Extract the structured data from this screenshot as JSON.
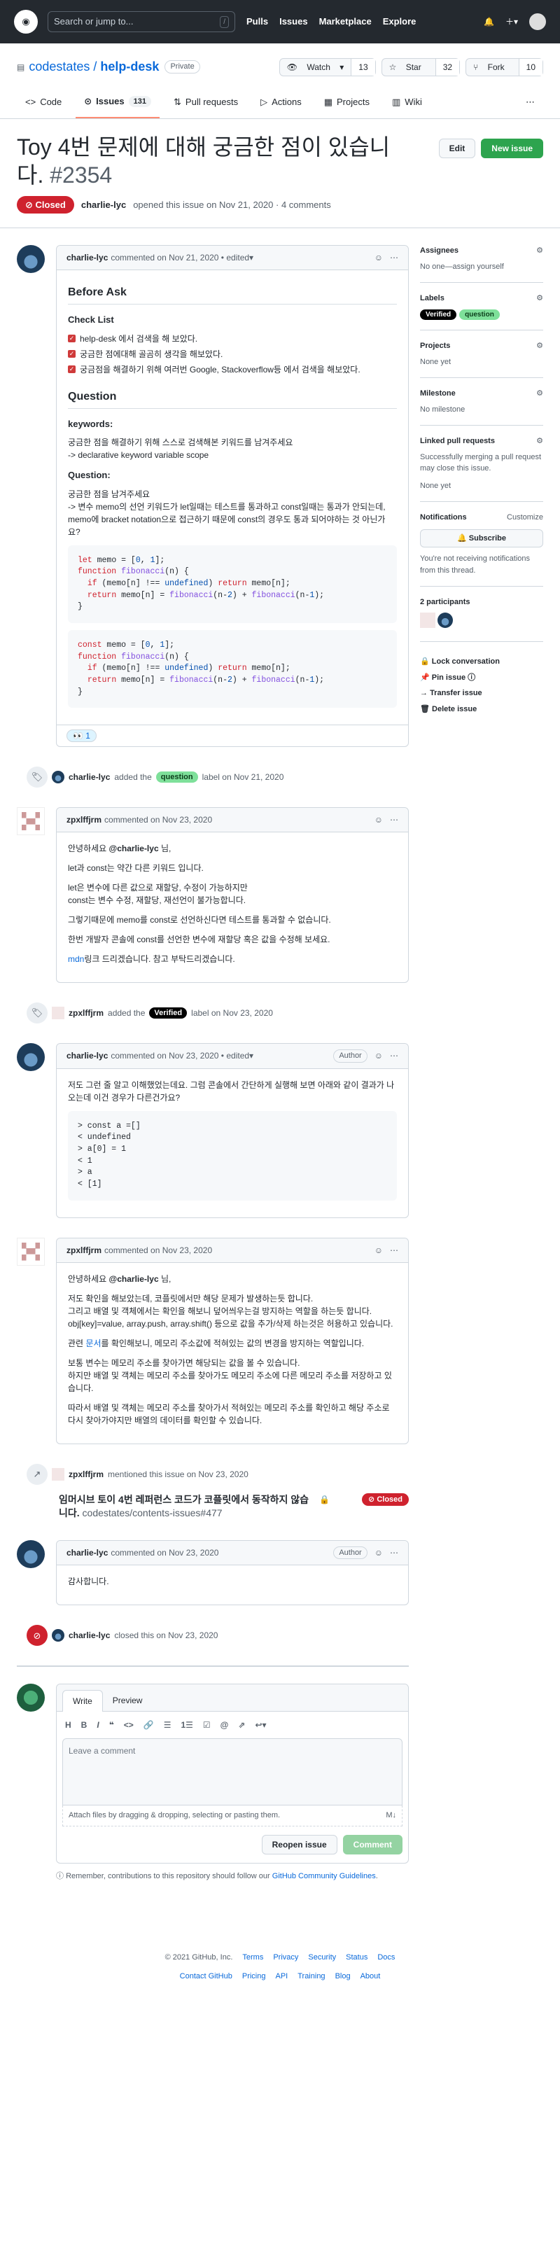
{
  "topbar": {
    "search_placeholder": "Search or jump to...",
    "slash": "/",
    "nav": [
      "Pulls",
      "Issues",
      "Marketplace",
      "Explore"
    ]
  },
  "repo": {
    "owner": "codestates",
    "name": "help-desk",
    "visibility": "Private",
    "watch": "Watch",
    "watch_count": "13",
    "star": "Star",
    "star_count": "32",
    "fork": "Fork",
    "fork_count": "10"
  },
  "tabs": {
    "code": "Code",
    "issues": "Issues",
    "issues_count": "131",
    "pulls": "Pull requests",
    "actions": "Actions",
    "projects": "Projects",
    "wiki": "Wiki"
  },
  "issue": {
    "title": "Toy 4번 문제에 대해 궁금한 점이 있습니다.",
    "number": "#2354",
    "edit": "Edit",
    "new_issue": "New issue",
    "state": "Closed",
    "author": "charlie-lyc",
    "opened": "opened this issue on Nov 21, 2020 · 4 comments"
  },
  "c1": {
    "author": "charlie-lyc",
    "meta": "commented on Nov 21, 2020 • edited",
    "h_before": "Before Ask",
    "h_check": "Check List",
    "checks": [
      "help-desk 에서 검색을 해 보았다.",
      "궁금한 점에대해 골곰히 생각을 해보았다.",
      "궁금점을 해결하기 위해 여러번 Google, Stackoverflow등 에서 검색을 해보았다."
    ],
    "h_question": "Question",
    "h_keywords": "keywords:",
    "kw1": "궁금한 점을 해결하기 위해 스스로 검색해본 키워드를 남겨주세요",
    "kw2": "-> declarative keyword variable scope",
    "h_q2": "Question:",
    "q1": "궁금한 점을 남겨주세요",
    "q2": "-> 변수 memo의 선언 키워드가 let일때는 테스트를 통과하고 const일때는 통과가 안되는데, memo에 bracket notation으로 접근하기 때문에 const의 경우도 통과 되어야하는 것 아닌가요?",
    "reaction": "👀 1"
  },
  "ev1": {
    "user": "charlie-lyc",
    "text": "added the",
    "label": "question",
    "after": "label on Nov 21, 2020"
  },
  "c2": {
    "author": "zpxlffjrm",
    "meta": "commented on Nov 23, 2020",
    "p1a": "안녕하세요",
    "mention": "@charlie-lyc",
    "p1b": "님,",
    "p2": "let과 const는 약간 다른 키워드 입니다.",
    "p3": "let은 변수에 다른 값으로 재할당, 수정이 가능하지만",
    "p3b": "const는 변수 수정, 재할당, 재선언이 불가능합니다.",
    "p4": "그렇기때문에 memo를 const로 선언하신다면 테스트를 통과할 수 없습니다.",
    "p5": "한번 개발자 콘솔에 const를 선언한 변수에 재할당 혹은 값을 수정해 보세요.",
    "link": "mdn",
    "p6": "링크 드리겠습니다. 참고 부탁드리겠습니다."
  },
  "ev2": {
    "user": "zpxlffjrm",
    "text": "added the",
    "label": "Verified",
    "after": "label on Nov 23, 2020"
  },
  "c3": {
    "author": "charlie-lyc",
    "meta": "commented on Nov 23, 2020 • edited",
    "badge": "Author",
    "p1": "저도 그런 줄 알고 이해했었는데요. 그럼 콘솔에서 간단하게 실행해 보면 아래와 같이 결과가 나오는데 이건 경우가 다른건가요?"
  },
  "c4": {
    "author": "zpxlffjrm",
    "meta": "commented on Nov 23, 2020",
    "p1a": "안녕하세요",
    "mention": "@charlie-lyc",
    "p1b": "님,",
    "p2": "저도 확인을 해보았는데, 코플릿에서만 해당 문제가 발생하는듯 합니다.",
    "p2b": "그리고 배열 및 객체에서는 확인을 해보니 덮어씌우는걸 방지하는 역할을 하는듯 합니다.",
    "p2c": "obj[key]=value, array.push, array.shift() 등으로 값을 추가/삭제 하는것은 허용하고 있습니다.",
    "p3a": "관련",
    "link": "문서",
    "p3b": "를 확인해보니, 메모리 주소값에 적혀있는 값의 변경을 방지하는 역할입니다.",
    "p4": "보통 변수는 메모리 주소를 찾아가면 해당되는 값을 볼 수 있습니다.",
    "p4b": "하지만 배열 및 객체는 메모리 주소를 찾아가도 메모리 주소에 다른 메모리 주소를 저장하고 있습니다.",
    "p5": "따라서 배열 및 객체는 메모리 주소를 찾아가서 적혀있는 메모리 주소를 확인하고 해당 주소로 다시 찾아가야지만 배열의 데이터를 확인할 수 있습니다."
  },
  "ev3": {
    "user": "zpxlffjrm",
    "text": "mentioned this issue on Nov 23, 2020",
    "ref_title": "임머시브 토이 4번 레퍼런스 코드가 코플릿에서 동작하지 않습니다.",
    "ref_repo": "codestates/contents-issues#477",
    "ref_state": "Closed"
  },
  "c5": {
    "author": "charlie-lyc",
    "meta": "commented on Nov 23, 2020",
    "badge": "Author",
    "p1": "감사합니다."
  },
  "ev4": {
    "user": "charlie-lyc",
    "text": "closed this on Nov 23, 2020"
  },
  "compose": {
    "write": "Write",
    "preview": "Preview",
    "placeholder": "Leave a comment",
    "attach": "Attach files by dragging & dropping, selecting or pasting them.",
    "reopen": "Reopen issue",
    "comment": "Comment",
    "note_a": "Remember, contributions to this repository should follow our",
    "note_link": "GitHub Community Guidelines",
    "note_b": "."
  },
  "sidebar": {
    "assignees": "Assignees",
    "assignees_val": "No one—assign yourself",
    "labels": "Labels",
    "label1": "Verified",
    "label2": "question",
    "projects": "Projects",
    "projects_val": "None yet",
    "milestone": "Milestone",
    "milestone_val": "No milestone",
    "linked": "Linked pull requests",
    "linked_desc": "Successfully merging a pull request may close this issue.",
    "linked_val": "None yet",
    "notifications": "Notifications",
    "customize": "Customize",
    "subscribe": "Subscribe",
    "notif_desc": "You're not receiving notifications from this thread.",
    "participants": "2 participants",
    "lock": "Lock conversation",
    "pin": "Pin issue",
    "transfer": "Transfer issue",
    "delete": "Delete issue"
  },
  "footer": {
    "copyright": "© 2021 GitHub, Inc.",
    "row1": [
      "Terms",
      "Privacy",
      "Security",
      "Status",
      "Docs"
    ],
    "row2": [
      "Contact GitHub",
      "Pricing",
      "API",
      "Training",
      "Blog",
      "About"
    ]
  },
  "colors": {
    "closed": "#cf222e",
    "green": "#2da44e",
    "question_label": "#7ee09a",
    "verified_label": "#000000"
  }
}
